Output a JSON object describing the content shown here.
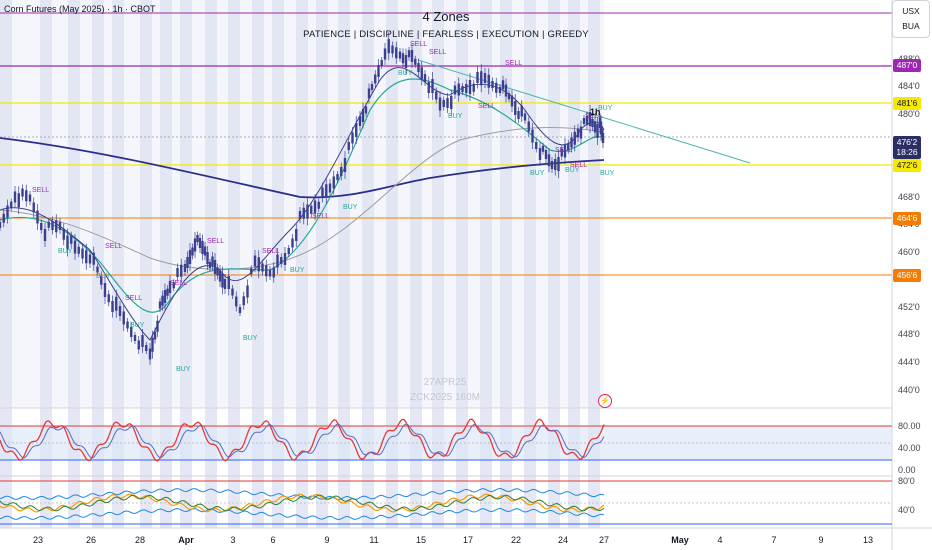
{
  "header": {
    "symbol_title": "Corn Futures (May 2025) · 1h · CBOT",
    "study_title": "4 Zones",
    "study_subtitle": "PATIENCE  |  DISCIPLINE  |  FEARLESS  |  EXECUTION  |  GREEDY",
    "timeframe_label": "1h"
  },
  "controls": {
    "currency": "USX",
    "unit": "BUA"
  },
  "watermark": {
    "line1": "27APR25",
    "line2": "ZCK2025 160M"
  },
  "price_axis": {
    "ticks": [
      "488'0",
      "484'0",
      "480'0",
      "476'0",
      "472'0",
      "468'0",
      "464'0",
      "460'0",
      "456'0",
      "452'0",
      "448'0",
      "444'0",
      "440'0"
    ],
    "tags": [
      {
        "text": "487'0",
        "color": "#9c27b0"
      },
      {
        "text": "481'6",
        "color": "#f5e900"
      },
      {
        "text": "476'2",
        "color": "#2a2e65"
      },
      {
        "text": "18:26",
        "color": "#2a2e65"
      },
      {
        "text": "472'6",
        "color": "#f5e900"
      },
      {
        "text": "464'6",
        "color": "#f57c00"
      },
      {
        "text": "456'6",
        "color": "#f57c00"
      }
    ]
  },
  "oscillators": {
    "stoch_ticks": [
      "80.00",
      "40.00",
      "0.00"
    ],
    "second_ticks": [
      "80'0",
      "40'0"
    ]
  },
  "time_axis": {
    "labels": [
      "23",
      "26",
      "28",
      "Apr",
      "3",
      "6",
      "9",
      "11",
      "15",
      "17",
      "22",
      "24",
      "27",
      "May",
      "4",
      "7",
      "9",
      "13"
    ]
  },
  "signals": [
    {
      "text": "SELL",
      "type": "sell"
    },
    {
      "text": "BUY",
      "type": "buy"
    },
    {
      "text": "SELL",
      "type": "sell"
    },
    {
      "text": "BUY",
      "type": "buy"
    },
    {
      "text": "BUY",
      "type": "buy"
    },
    {
      "text": "SELL",
      "type": "sell"
    },
    {
      "text": "SELL",
      "type": "sell"
    },
    {
      "text": "BUY",
      "type": "buy"
    },
    {
      "text": "SELL",
      "type": "sell"
    },
    {
      "text": "BUY",
      "type": "buy"
    },
    {
      "text": "SELL",
      "type": "sell"
    },
    {
      "text": "BUY",
      "type": "buy"
    },
    {
      "text": "SELL",
      "type": "sell"
    },
    {
      "text": "BUY",
      "type": "buy"
    },
    {
      "text": "SELL",
      "type": "sell"
    },
    {
      "text": "BUY",
      "type": "buy"
    },
    {
      "text": "SELL",
      "type": "sell"
    },
    {
      "text": "BUY",
      "type": "buy"
    },
    {
      "text": "SELL",
      "type": "sell"
    },
    {
      "text": "SELL",
      "type": "sell"
    },
    {
      "text": "BUY",
      "type": "buy"
    },
    {
      "text": "SELL",
      "type": "sell"
    },
    {
      "text": "BUY",
      "type": "buy"
    },
    {
      "text": "BUY",
      "type": "buy"
    },
    {
      "text": "SELL",
      "type": "sell"
    },
    {
      "text": "BUY",
      "type": "buy"
    },
    {
      "text": "SELL",
      "type": "sell"
    }
  ],
  "colors": {
    "zone_purple": "#9c27b0",
    "zone_yellow": "#f5e900",
    "zone_orange": "#f57c00",
    "ma_dark": "#2a2e8c",
    "ma_teal": "#26a69a",
    "ma_gray": "#9e9e9e",
    "trend": "#4db6ac",
    "candle": "#3a3f8f",
    "sell": "#9c27b0",
    "buy": "#26a69a"
  }
}
